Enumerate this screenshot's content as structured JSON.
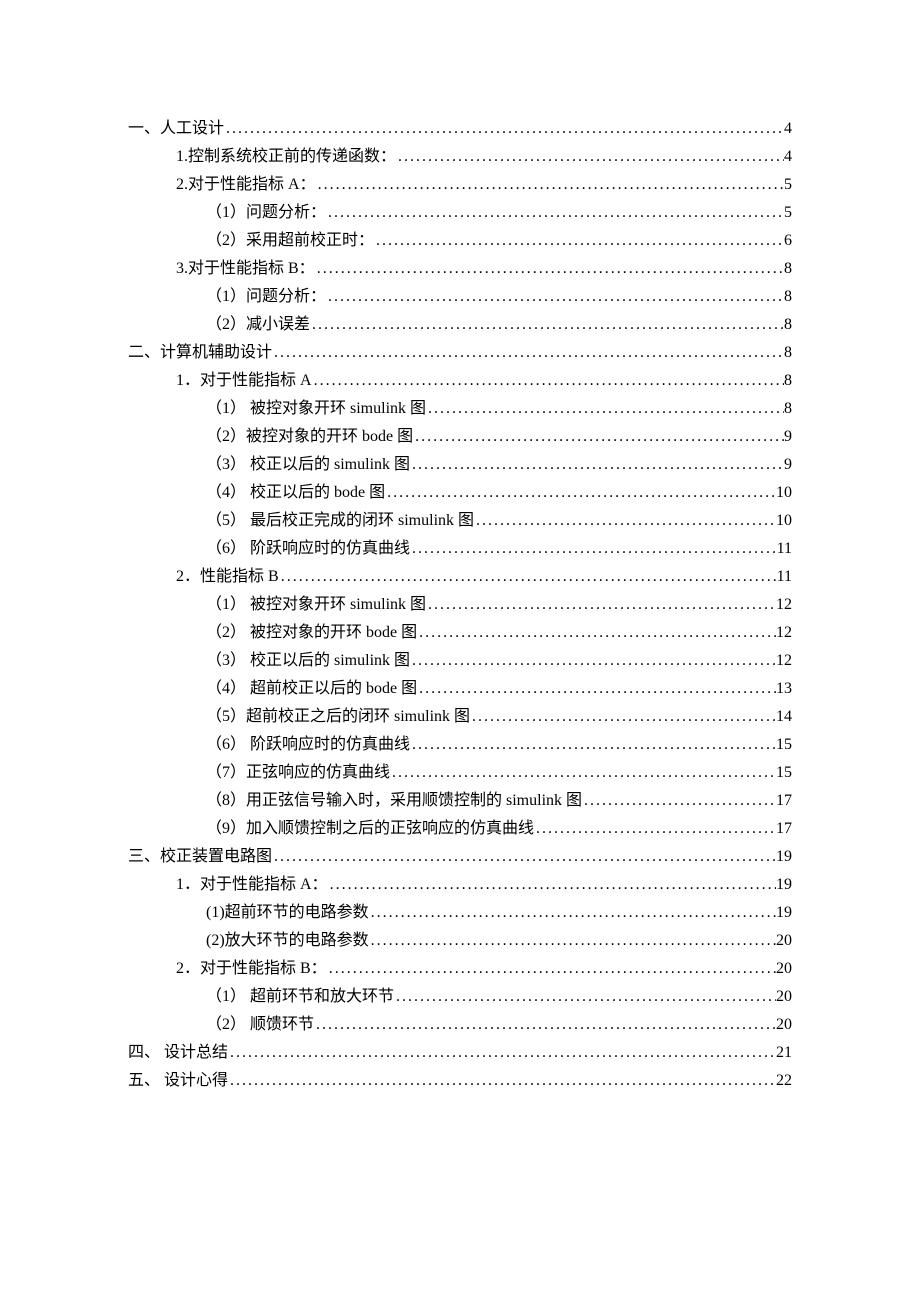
{
  "toc": [
    {
      "level": 0,
      "text": "一、人工设计",
      "page": "4"
    },
    {
      "level": 1,
      "text": "1.控制系统校正前的传递函数：",
      "page": "4"
    },
    {
      "level": 1,
      "text": "2.对于性能指标 A：",
      "page": "5"
    },
    {
      "level": 2,
      "text": "（1）问题分析：",
      "page": "5"
    },
    {
      "level": 2,
      "text": "（2）采用超前校正时：",
      "page": "6"
    },
    {
      "level": 1,
      "text": "3.对于性能指标 B：",
      "page": "8"
    },
    {
      "level": 2,
      "text": "（1）问题分析：",
      "page": "8"
    },
    {
      "level": 2,
      "text": "（2）减小误差",
      "page": "8"
    },
    {
      "level": 0,
      "text": "二、计算机辅助设计",
      "page": "8"
    },
    {
      "level": 1,
      "text": "1．对于性能指标 A ",
      "page": "8"
    },
    {
      "level": 2,
      "text": "（1） 被控对象开环 simulink 图",
      "page": "8"
    },
    {
      "level": 2,
      "text": "（2）被控对象的开环 bode 图",
      "page": "9"
    },
    {
      "level": 2,
      "text": "（3） 校正以后的 simulink 图",
      "page": "9"
    },
    {
      "level": 2,
      "text": "（4） 校正以后的 bode 图",
      "page": "10"
    },
    {
      "level": 2,
      "text": "（5） 最后校正完成的闭环 simulink 图",
      "page": "10"
    },
    {
      "level": 2,
      "text": "（6） 阶跃响应时的仿真曲线",
      "page": "11"
    },
    {
      "level": 1,
      "text": "2．性能指标 B",
      "page": "11"
    },
    {
      "level": 2,
      "text": "（1） 被控对象开环 simulink 图",
      "page": "12"
    },
    {
      "level": 2,
      "text": "（2） 被控对象的开环 bode 图",
      "page": "12"
    },
    {
      "level": 2,
      "text": "（3） 校正以后的 simulink 图",
      "page": "12"
    },
    {
      "level": 2,
      "text": "（4） 超前校正以后的 bode 图",
      "page": "13"
    },
    {
      "level": 2,
      "text": "（5）超前校正之后的闭环 simulink 图",
      "page": "14"
    },
    {
      "level": 2,
      "text": "（6） 阶跃响应时的仿真曲线",
      "page": "15"
    },
    {
      "level": 2,
      "text": "（7）正弦响应的仿真曲线",
      "page": "15"
    },
    {
      "level": 2,
      "text": "（8）用正弦信号输入时，采用顺馈控制的 simulink 图",
      "page": "17"
    },
    {
      "level": 2,
      "text": "（9）加入顺馈控制之后的正弦响应的仿真曲线",
      "page": "17"
    },
    {
      "level": 0,
      "text": "三、校正装置电路图",
      "page": "19"
    },
    {
      "level": 1,
      "text": "1．对于性能指标 A：",
      "page": "19"
    },
    {
      "level": 2,
      "text": "(1)超前环节的电路参数",
      "page": "19"
    },
    {
      "level": 2,
      "text": "(2)放大环节的电路参数",
      "page": "20"
    },
    {
      "level": 1,
      "text": "2．对于性能指标 B：",
      "page": "20"
    },
    {
      "level": 2,
      "text": "（1） 超前环节和放大环节",
      "page": "20"
    },
    {
      "level": 2,
      "text": "（2） 顺馈环节",
      "page": "20"
    },
    {
      "level": 0,
      "text": "四、 设计总结",
      "page": "21"
    },
    {
      "level": 0,
      "text": "五、 设计心得",
      "page": "22"
    }
  ],
  "leader": "................................................................................................................................................................................................"
}
